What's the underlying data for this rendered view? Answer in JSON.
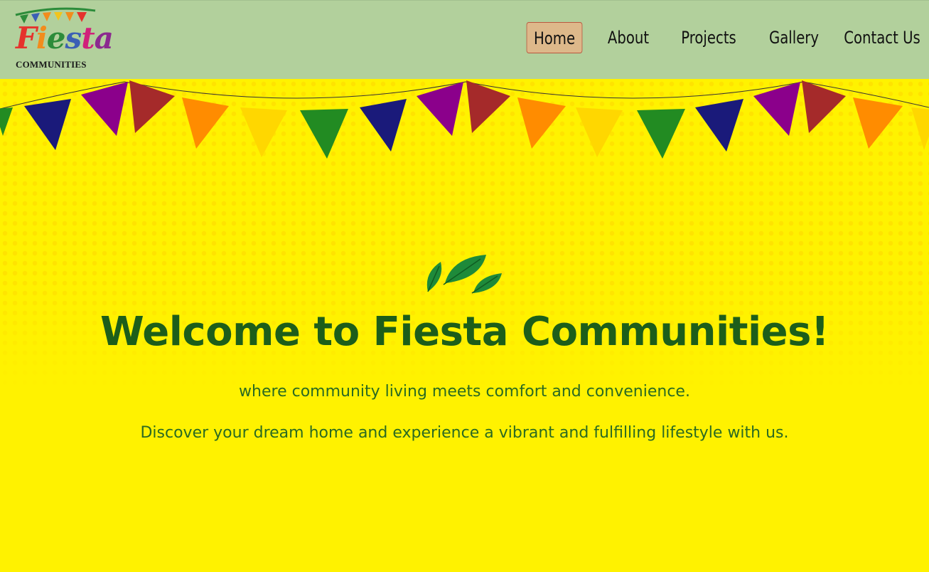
{
  "logo": {
    "script_text": "Fiesta",
    "subtitle": "COMMUNITIES",
    "letter_colors": [
      "#e5322d",
      "#f28c1c",
      "#2c8c3a",
      "#3b5fb5",
      "#d0207a",
      "#8b2a8f"
    ],
    "flag_colors": [
      "#2c8c3a",
      "#f28c1c",
      "#e5322d",
      "#2c8c3a",
      "#f2c41c",
      "#e5322d"
    ]
  },
  "nav": {
    "items": [
      {
        "label": "Home",
        "active": true
      },
      {
        "label": "About",
        "active": false
      },
      {
        "label": "Projects",
        "active": false
      },
      {
        "label": "Gallery",
        "active": false
      },
      {
        "label": "Contact Us",
        "active": false
      }
    ]
  },
  "hero": {
    "title": "Welcome to Fiesta Communities!",
    "subtitle": "where community living meets comfort and convenience.",
    "tagline": "Discover your dream home and experience a vibrant and fulfilling lifestyle with us.",
    "icon": "leaves-icon",
    "bunting_colors": [
      "#228b22",
      "#1a1a7a",
      "#8b008b",
      "#a52a2a",
      "#ff8c00",
      "#ffd700"
    ]
  },
  "colors": {
    "header_bg": "#b2d09c",
    "hero_bg": "#fff200",
    "title": "#1d5e1a",
    "body_text": "#2a6a22",
    "active_nav_bg": "#ddb88a",
    "active_nav_border": "#b9573f"
  }
}
